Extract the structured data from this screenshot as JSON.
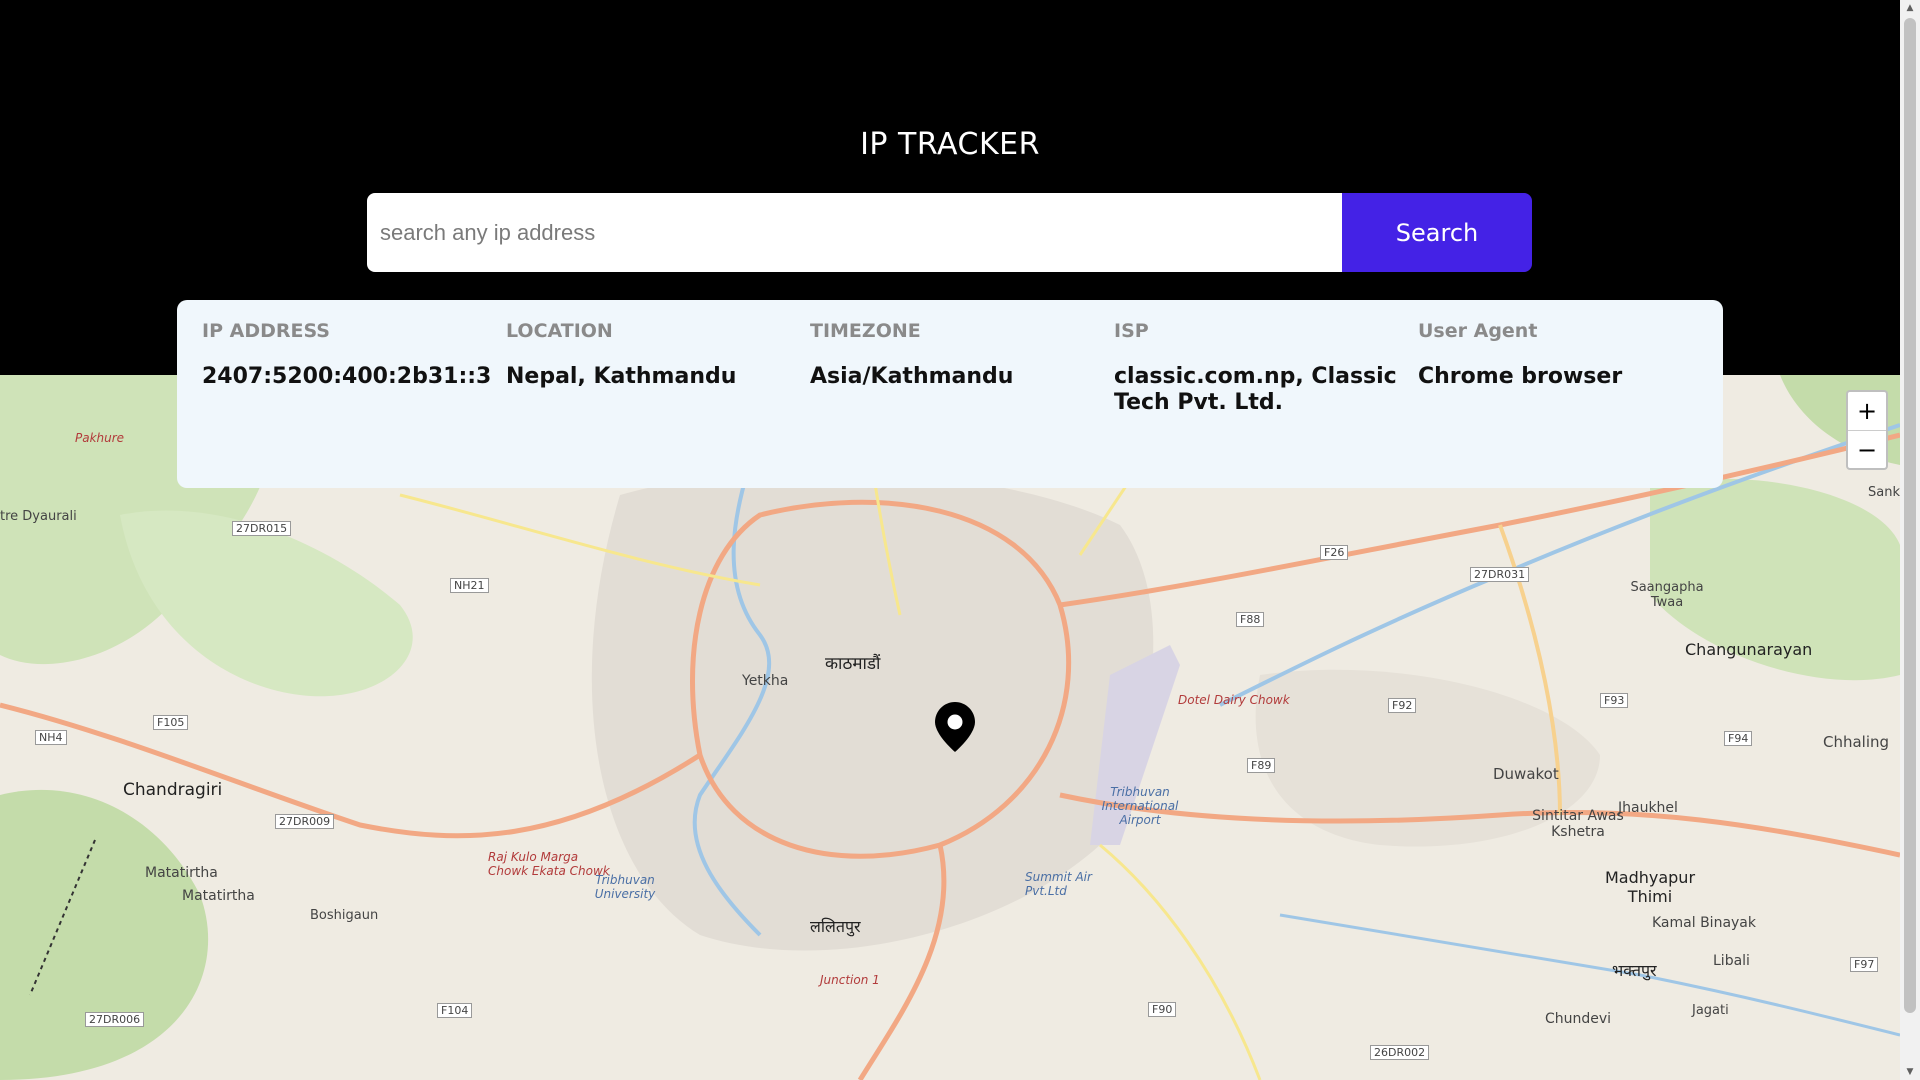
{
  "header": {
    "title": "IP TRACKER",
    "background": "#000000"
  },
  "search": {
    "placeholder": "search any ip address",
    "value": "",
    "button_label": "Search",
    "button_color": "#4422e6"
  },
  "info": {
    "ip_label": "IP ADDRESS",
    "ip_value": "2407:5200:400:2b31::3",
    "location_label": "LOCATION",
    "location_value": "Nepal, Kathmandu",
    "timezone_label": "TIMEZONE",
    "timezone_value": "Asia/Kathmandu",
    "isp_label": "ISP",
    "isp_value": "classic.com.np, Classic Tech Pvt. Ltd.",
    "ua_label": "User Agent",
    "ua_value": "Chrome browser"
  },
  "map": {
    "zoom_in": "+",
    "zoom_out": "−",
    "marker_icon": "location-pin-icon",
    "labels": {
      "kathmandu": "काठमाडौं",
      "chandragiri": "Chandragiri",
      "changunarayan": "Changunarayan",
      "madhyapur": "Madhyapur Thimi",
      "duwakot": "Duwakot",
      "jhaukhel": "Jhaukhel",
      "kamal": "Kamal Binayak",
      "libali": "Libali",
      "chhaling": "Chhaling",
      "matatirtha1": "Matatirtha",
      "matatirtha2": "Matatirtha",
      "boshigaun": "Boshigaun",
      "yetkha": "Yetkha",
      "sintitar": "Sintitar Awas Kshetra",
      "sangapha": "Saangapha Twaa",
      "chundevi": "Chundevi",
      "jagati": "Jagati",
      "pakhure": "Pakhure",
      "dyaurali": "tre Dyaurali",
      "dotel": "Dotel Dairy Chowk",
      "tribhuvan_airport": "Tribhuvan International Airport",
      "tribhuvan_uni": "Tribhuvan University",
      "rajkulo": "Raj Kulo Marga Chowk Ekata Chowk",
      "summit": "Summit Air Pvt.Ltd",
      "junction": "Junction 1",
      "lalitpur": "ललितपुर",
      "bhaktapur": "भक्तपुर",
      "sanka": "Sank",
      "nh21": "NH21",
      "nh4": "NH4",
      "f105": "F105",
      "f104": "F104",
      "f26": "F26",
      "f88": "F88",
      "f92": "F92",
      "f93": "F93",
      "f94": "F94",
      "f89": "F89",
      "f90": "F90",
      "f97": "F97",
      "r27dr015": "27DR015",
      "r27dr009": "27DR009",
      "r27dr006": "27DR006",
      "r27dr031": "27DR031",
      "r26dr002": "26DR002"
    }
  }
}
